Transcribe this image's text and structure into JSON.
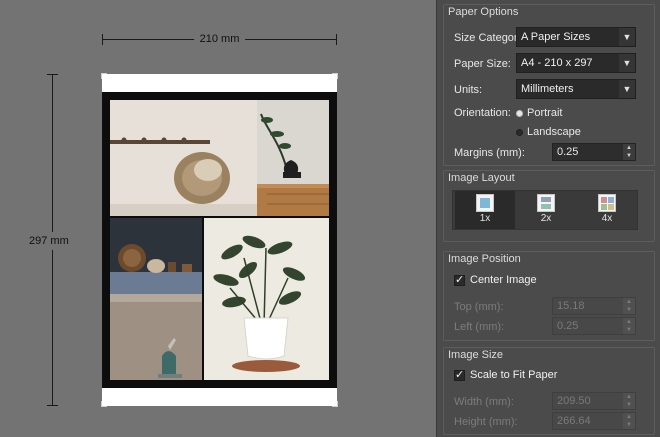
{
  "preview": {
    "width_label": "210 mm",
    "height_label": "297 mm"
  },
  "paper_options": {
    "title": "Paper Options",
    "size_category_label": "Size Category:",
    "size_category_value": "A Paper Sizes",
    "paper_size_label": "Paper Size:",
    "paper_size_value": "A4 - 210 x 297",
    "units_label": "Units:",
    "units_value": "Millimeters",
    "orientation_label": "Orientation:",
    "portrait_label": "Portrait",
    "landscape_label": "Landscape",
    "orientation_selected": "Portrait",
    "margins_label": "Margins (mm):",
    "margins_value": "0.25"
  },
  "image_layout": {
    "title": "Image Layout",
    "options": [
      {
        "label": "1x",
        "icon": "single-image-icon"
      },
      {
        "label": "2x",
        "icon": "two-images-icon"
      },
      {
        "label": "4x",
        "icon": "four-images-icon"
      }
    ],
    "selected": "1x"
  },
  "image_position": {
    "title": "Image Position",
    "center_label": "Center Image",
    "center_checked": true,
    "top_label": "Top (mm):",
    "top_value": "15.18",
    "left_label": "Left (mm):",
    "left_value": "0.25"
  },
  "image_size": {
    "title": "Image Size",
    "scale_label": "Scale to Fit Paper",
    "scale_checked": true,
    "width_label": "Width (mm):",
    "width_value": "209.50",
    "height_label": "Height (mm):",
    "height_value": "266.64"
  },
  "colors": {
    "preview_bg": "#737373",
    "sidebar_bg": "#4b4b4b",
    "input_bg": "#2a2a2a"
  }
}
